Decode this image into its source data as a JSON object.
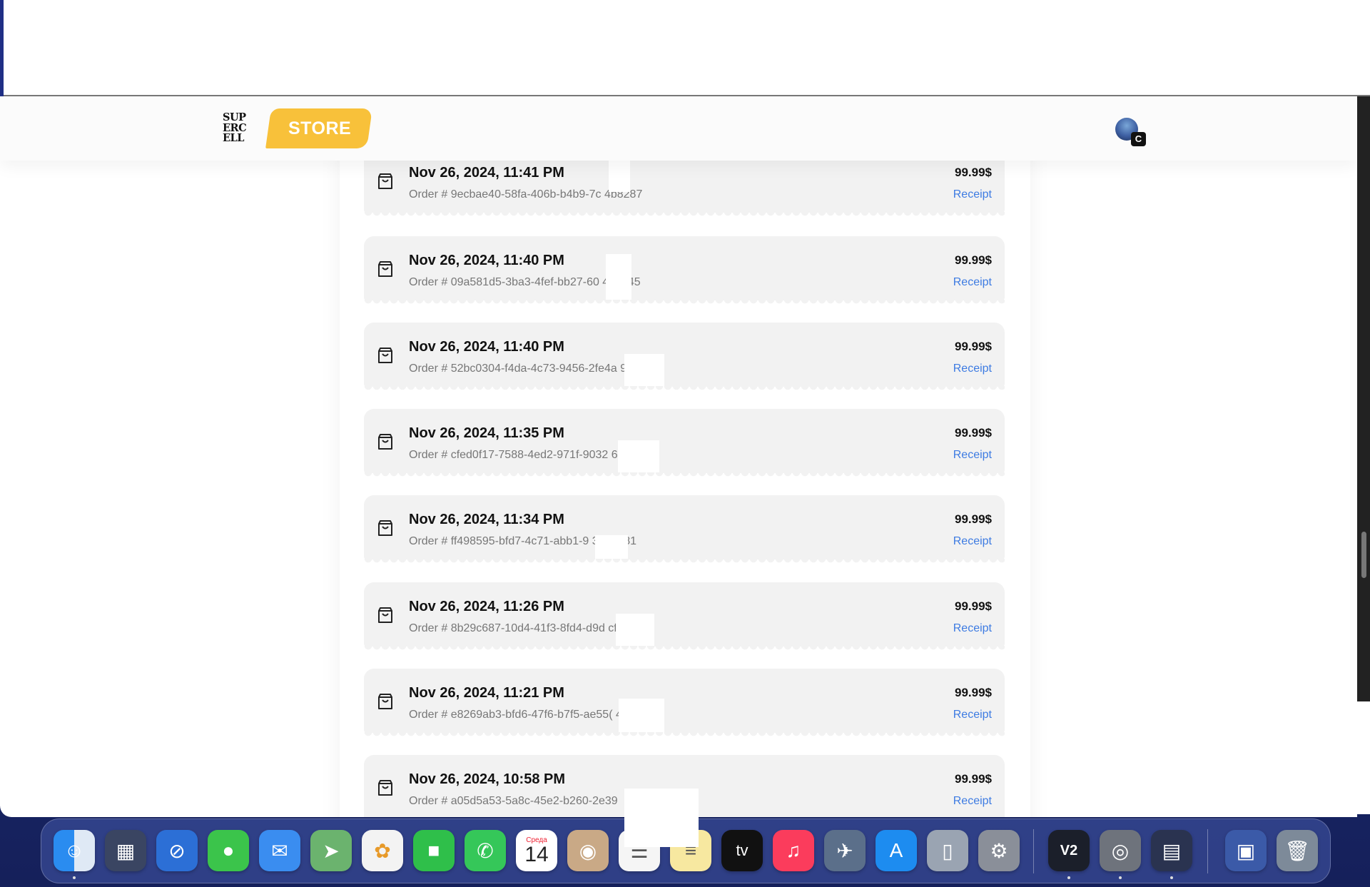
{
  "header": {
    "logo_text": "SUP\nERC\nELL",
    "store_label": "STORE",
    "avatar_badge": "C"
  },
  "orders": [
    {
      "date": "Nov 26, 2024, 11:41 PM",
      "order_id": "Order # 9ecbae40-58fa-406b-b4b9-7c      4b8287",
      "price": "99.99$",
      "receipt": "Receipt"
    },
    {
      "date": "Nov 26, 2024, 11:40 PM",
      "order_id": "Order # 09a581d5-3ba3-4fef-bb27-60      4a6145",
      "price": "99.99$",
      "receipt": "Receipt"
    },
    {
      "date": "Nov 26, 2024, 11:40 PM",
      "order_id": "Order # 52bc0304-f4da-4c73-9456-2fe4a          9",
      "price": "99.99$",
      "receipt": "Receipt"
    },
    {
      "date": "Nov 26, 2024, 11:35 PM",
      "order_id": "Order # cfed0f17-7588-4ed2-971f-9032        64",
      "price": "99.99$",
      "receipt": "Receipt"
    },
    {
      "date": "Nov 26, 2024, 11:34 PM",
      "order_id": "Order # ff498595-bfd7-4c71-abb1-9       31b0e81",
      "price": "99.99$",
      "receipt": "Receipt"
    },
    {
      "date": "Nov 26, 2024, 11:26 PM",
      "order_id": "Order # 8b29c687-10d4-41f3-8fd4-d9d        cf0",
      "price": "99.99$",
      "receipt": "Receipt"
    },
    {
      "date": "Nov 26, 2024, 11:21 PM",
      "order_id": "Order # e8269ab3-bfd6-47f6-b7f5-ae55(         4",
      "price": "99.99$",
      "receipt": "Receipt"
    },
    {
      "date": "Nov 26, 2024, 10:58 PM",
      "order_id": "Order # a05d5a53-5a8c-45e2-b260-2e39",
      "price": "99.99$",
      "receipt": "Receipt"
    }
  ],
  "dock": {
    "calendar_month": "Среда",
    "calendar_day": "14",
    "tv_label": "tv",
    "v2_label": "V2",
    "items": [
      "finder-icon",
      "launchpad-icon",
      "safari-icon",
      "messages-icon",
      "mail-icon",
      "maps-icon",
      "photos-icon",
      "facetime-icon",
      "phone-icon",
      "calendar-icon",
      "contacts-icon",
      "reminders-icon",
      "notes-icon",
      "appletv-icon",
      "music-icon",
      "rocket-icon",
      "appstore-icon",
      "iphone-mirroring-icon",
      "system-settings-icon",
      "v2-app-icon",
      "chrome-icon",
      "numbers-icon",
      "screenshot-icon",
      "trash-icon"
    ]
  }
}
